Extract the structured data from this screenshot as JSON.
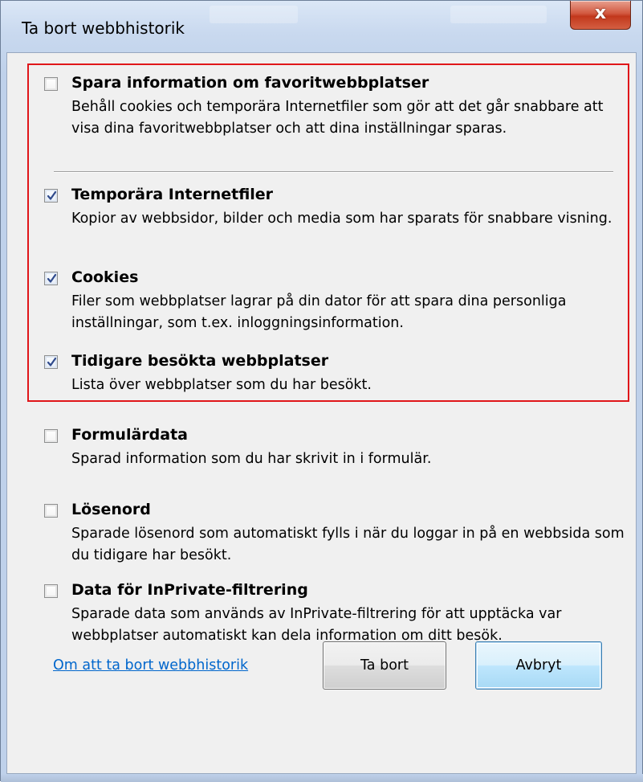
{
  "window": {
    "title": "Ta bort webbhistorik",
    "close_symbol": "x"
  },
  "options": [
    {
      "title": "Spara information om favoritwebbplatser",
      "description": "Behåll cookies och temporära Internetfiler som gör att det går snabbare att visa dina favoritwebbplatser och att dina inställningar sparas.",
      "checked": false
    },
    {
      "title": "Temporära Internetfiler",
      "description": "Kopior av webbsidor, bilder och media som har sparats för snabbare visning.",
      "checked": true
    },
    {
      "title": "Cookies",
      "description": "Filer som webbplatser lagrar på din dator för att spara dina personliga inställningar, som t.ex. inloggningsinformation.",
      "checked": true
    },
    {
      "title": "Tidigare besökta webbplatser",
      "description": "Lista över webbplatser som du har besökt.",
      "checked": true
    },
    {
      "title": "Formulärdata",
      "description": "Sparad information som du har skrivit in i formulär.",
      "checked": false
    },
    {
      "title": "Lösenord",
      "description": "Sparade lösenord som automatiskt fylls i när du loggar in på en webbsida som du tidigare har besökt.",
      "checked": false
    },
    {
      "title": "Data för InPrivate-filtrering",
      "description": "Sparade data som används av InPrivate-filtrering för att upptäcka var webbplatser automatiskt kan dela information om ditt besök.",
      "checked": false
    }
  ],
  "footer": {
    "help_link": "Om att ta bort webbhistorik",
    "delete_button": "Ta bort",
    "cancel_button": "Avbryt"
  },
  "colors": {
    "highlight_border": "#e0161a",
    "link": "#0066cc",
    "checkmark": "#2f4a8c"
  }
}
